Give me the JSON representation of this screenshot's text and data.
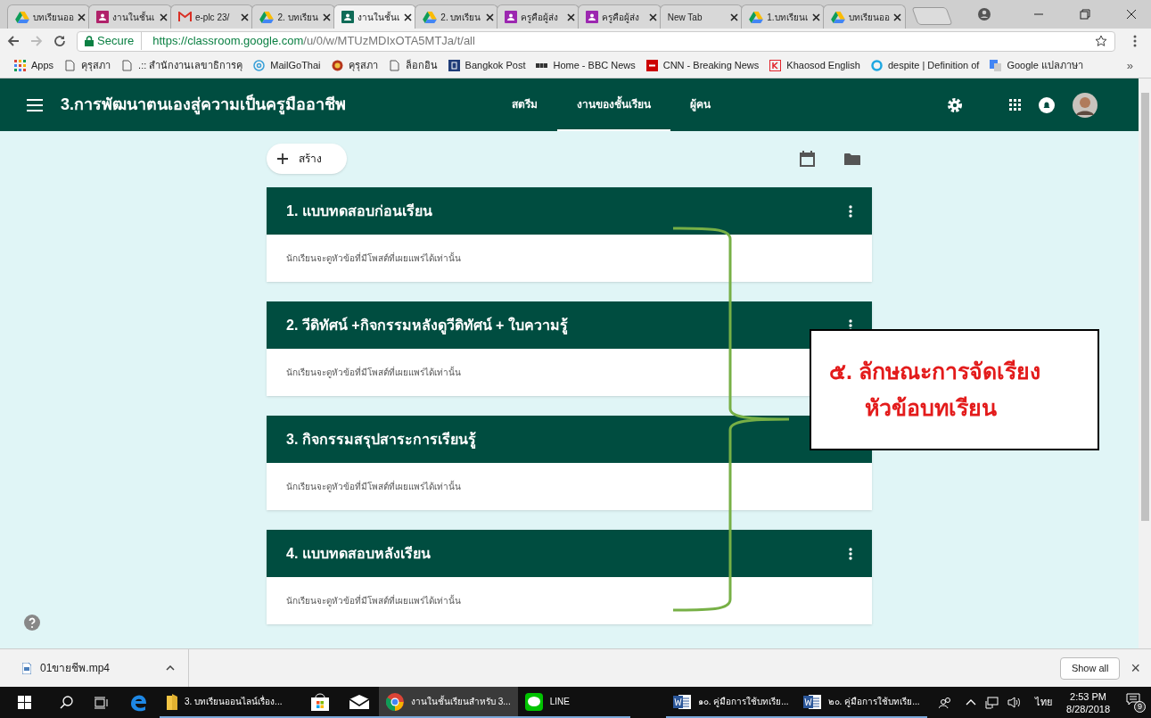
{
  "browser_tabs": [
    {
      "title": "บทเรียนออ",
      "kind": "drive",
      "selected": false
    },
    {
      "title": "งานในชั้นเ",
      "kind": "classroom",
      "color": "#b0226a",
      "selected": false
    },
    {
      "title": "e-plc 23/",
      "kind": "gmail",
      "selected": false
    },
    {
      "title": "2. บทเรียน",
      "kind": "drive",
      "selected": false
    },
    {
      "title": "งานในชั้นเ",
      "kind": "classroom",
      "color": "#0f6b57",
      "selected": true
    },
    {
      "title": "2. บทเรียน",
      "kind": "drive",
      "selected": false
    },
    {
      "title": "ครูคือผู้ส่ง",
      "kind": "classroom",
      "color": "#9c27b0",
      "selected": false
    },
    {
      "title": "ครูคือผู้ส่ง",
      "kind": "classroom",
      "color": "#9c27b0",
      "selected": false
    },
    {
      "title": "New Tab",
      "kind": "plain",
      "selected": false
    },
    {
      "title": "1.บทเรียนเ",
      "kind": "drive",
      "selected": false
    },
    {
      "title": "บทเรียนออ",
      "kind": "drive",
      "selected": false
    }
  ],
  "address_bar": {
    "secure_label": "Secure",
    "url_host": "https://classroom.google.com",
    "url_path": "/u/0/w/MTUzMDIxOTA5MTJa/t/all"
  },
  "bookmarks": [
    {
      "label": "Apps",
      "kind": "apps"
    },
    {
      "label": "คุรุสภา",
      "kind": "page"
    },
    {
      "label": ".:: สำนักงานเลขาธิการคุ",
      "kind": "page"
    },
    {
      "label": "MailGoThai",
      "kind": "at"
    },
    {
      "label": "คุรุสภา",
      "kind": "seal"
    },
    {
      "label": "ล็อกอิน",
      "kind": "page"
    },
    {
      "label": "Bangkok Post",
      "kind": "b"
    },
    {
      "label": "Home - BBC News",
      "kind": "bbc"
    },
    {
      "label": "CNN - Breaking News",
      "kind": "cnn"
    },
    {
      "label": "Khaosod English",
      "kind": "k"
    },
    {
      "label": "despite | Definition of",
      "kind": "ring"
    },
    {
      "label": "Google แปลภาษา",
      "kind": "translate"
    }
  ],
  "bookmarks_more": "»",
  "app_header": {
    "class_title": "3.การพัฒนาตนเองสู่ความเป็นครูมืออาชีพ",
    "tabs": [
      {
        "label": "สตรีม",
        "selected": false
      },
      {
        "label": "งานของชั้นเรียน",
        "selected": true
      },
      {
        "label": "ผู้คน",
        "selected": false
      }
    ]
  },
  "create_button": "สร้าง",
  "topics": [
    {
      "title": "1. แบบทดสอบก่อนเรียน",
      "note": "นักเรียนจะดูหัวข้อที่มีโพสต์ที่เผยแพร่ได้เท่านั้น"
    },
    {
      "title": "2. วีดิทัศน์ +กิจกรรมหลังดูวีดิทัศน์ + ใบความรู้",
      "note": "นักเรียนจะดูหัวข้อที่มีโพสต์ที่เผยแพร่ได้เท่านั้น"
    },
    {
      "title": "3. กิจกรรมสรุปสาระการเรียนรู้",
      "note": "นักเรียนจะดูหัวข้อที่มีโพสต์ที่เผยแพร่ได้เท่านั้น"
    },
    {
      "title": "4. แบบทดสอบหลังเรียน",
      "note": "นักเรียนจะดูหัวข้อที่มีโพสต์ที่เผยแพร่ได้เท่านั้น"
    }
  ],
  "annotation": {
    "lines": [
      "๕. ลักษณะการจัดเรียง",
      "หัวข้อบทเรียน"
    ]
  },
  "download_bar": {
    "file": "01ขายชีพ.mp4",
    "show_all": "Show all",
    "close": "×"
  },
  "taskbar": {
    "apps": [
      {
        "kind": "folder",
        "label": "3. บทเรียนออนไลน์เรื่อง...",
        "selected": false
      },
      {
        "kind": "store",
        "selected": false
      },
      {
        "kind": "mail",
        "selected": false
      },
      {
        "kind": "chrome",
        "label": "งานในชั้นเรียนสำหรับ 3...",
        "selected": true
      },
      {
        "kind": "line",
        "label": "LINE",
        "selected": false
      },
      {
        "kind": "word",
        "label": "๑๐. คู่มือการใช้บทเรีย...",
        "selected": false
      },
      {
        "kind": "word",
        "label": "๒๐. คู่มือการใช้บทเรีย...",
        "selected": false
      }
    ],
    "language": "ไทย",
    "time": "2:53 PM",
    "date": "8/28/2018",
    "notifications": "9"
  }
}
